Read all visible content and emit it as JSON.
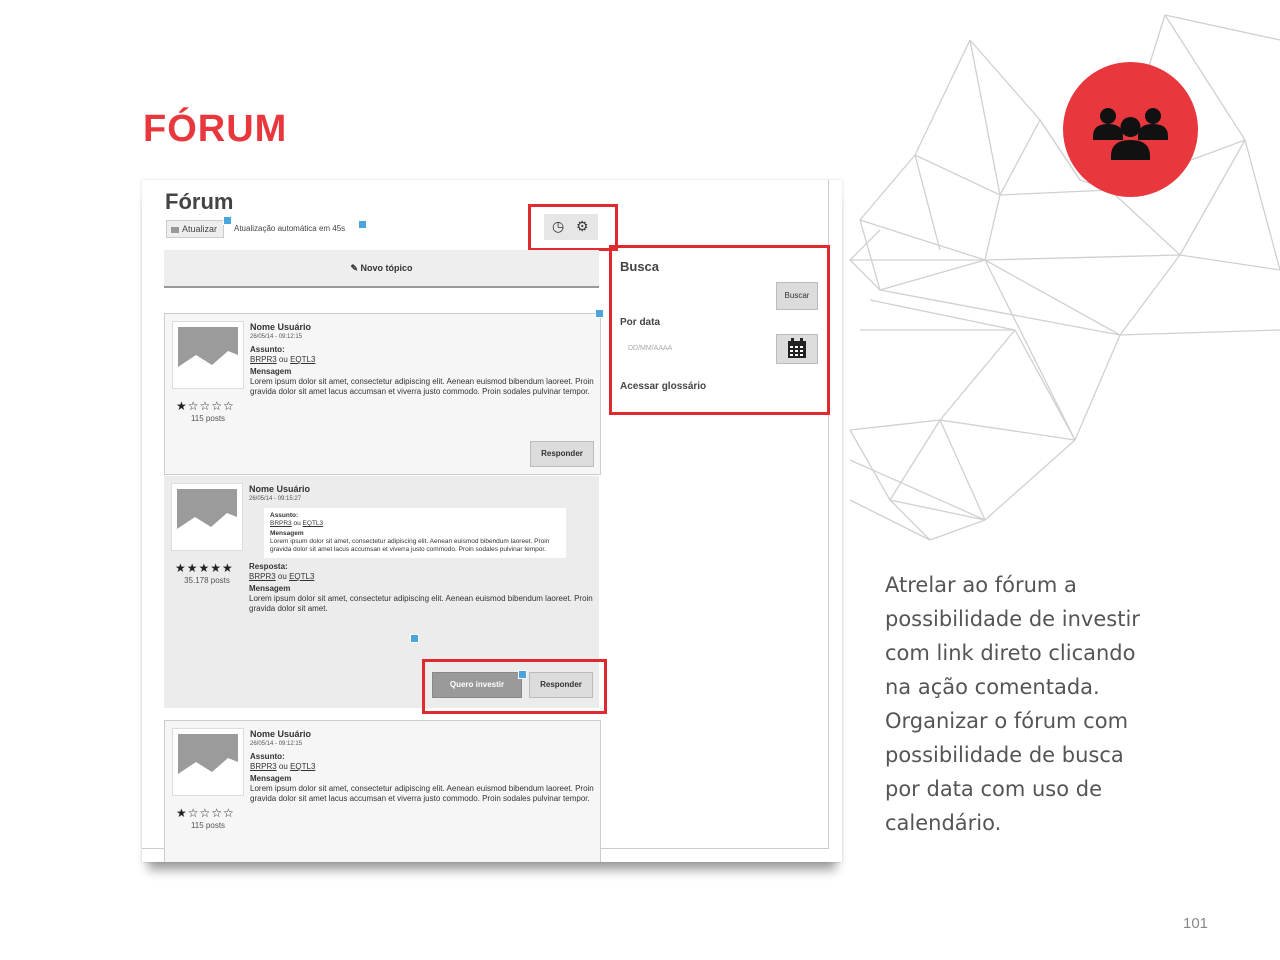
{
  "slide": {
    "title": "FÓRUM",
    "caption_lines": [
      "Atrelar ao fórum a",
      "possibilidade de investir",
      "com link direto clicando",
      "na ação comentada.",
      "Organizar o fórum com",
      "possibilidade de busca",
      "por data com uso de",
      "calendário."
    ],
    "page_number": "101",
    "accent_color": "#e8383d",
    "badge_icon": "group-users-icon"
  },
  "forum": {
    "title": "Fórum",
    "refresh_label": "Atualizar",
    "auto_refresh_text": "Atualização automática em 45s",
    "history_icon": "clock-icon",
    "settings_icon": "gear-icon",
    "new_topic_label": "Novo tópico",
    "posts": [
      {
        "user": "Nome Usuário",
        "date": "26/05/14 - 09:12:15",
        "subject_label": "Assunto:",
        "ticker1": "BRPR3",
        "or": "ou",
        "ticker2": "EQTL3",
        "message_label": "Mensagem",
        "message": "Lorem ipsum dolor sit amet, consectetur adipiscing elit. Aenean euismod bibendum laoreet. Proin gravida dolor sit amet lacus accumsan et viverra justo commodo. Proin sodales pulvinar tempor.",
        "stars": "★☆☆☆☆",
        "post_count": "115 posts",
        "reply_label": "Responder"
      },
      {
        "user": "Nome Usuário",
        "date": "26/05/14 - 09:15:27",
        "quote": {
          "subject_label": "Assunto:",
          "ticker1": "BRPR3",
          "or": "ou",
          "ticker2": "EQTL3",
          "message_label": "Mensagem",
          "message": "Lorem ipsum dolor sit amet, consectetur adipiscing elit. Aenean euismod bibendum laoreet. Proin gravida dolor sit amet lacus accumsan et viverra justo commodo. Proin sodales pulvinar tempor."
        },
        "answer_label": "Resposta:",
        "ticker1": "BRPR3",
        "or": "ou",
        "ticker2": "EQTL3",
        "message_label": "Mensagem",
        "message": "Lorem ipsum dolor sit amet, consectetur adipiscing elit. Aenean euismod bibendum laoreet. Proin gravida dolor sit amet.",
        "stars": "★★★★★",
        "post_count": "35.178 posts",
        "invest_label": "Quero investir",
        "reply_label": "Responder"
      },
      {
        "user": "Nome Usuário",
        "date": "26/05/14 - 09:12:15",
        "subject_label": "Assunto:",
        "ticker1": "BRPR3",
        "or": "ou",
        "ticker2": "EQTL3",
        "message_label": "Mensagem",
        "message": "Lorem ipsum dolor sit amet, consectetur adipiscing elit. Aenean euismod bibendum laoreet. Proin gravida dolor sit amet lacus accumsan et viverra justo commodo. Proin sodales pulvinar tempor.",
        "stars": "★☆☆☆☆",
        "post_count": "115 posts"
      }
    ],
    "search": {
      "title": "Busca",
      "search_button": "Buscar",
      "date_label": "Por data",
      "date_placeholder": "DD/MM/AAAA",
      "calendar_icon": "calendar-icon",
      "glossary_link": "Acessar glossário"
    }
  }
}
